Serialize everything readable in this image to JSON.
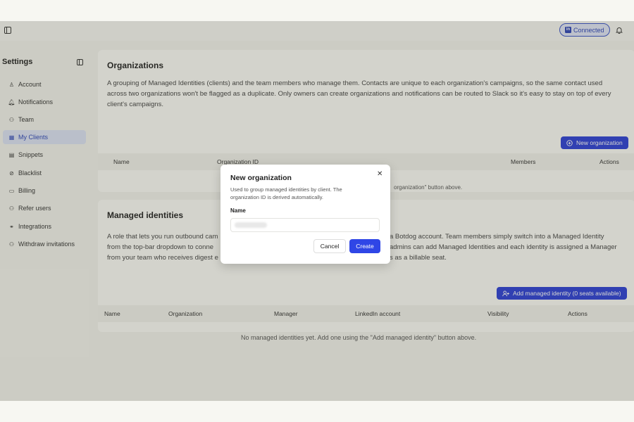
{
  "topbar": {
    "connected_label": "Connected",
    "linkedin_icon": "linkedin-icon",
    "bell_icon": "bell-icon"
  },
  "sidebar": {
    "title": "Settings",
    "items": [
      {
        "label": "Account",
        "icon": "user-icon",
        "glyph": "♙"
      },
      {
        "label": "Notifications",
        "icon": "bell-icon",
        "glyph": "🔔︎"
      },
      {
        "label": "Team",
        "icon": "team-icon",
        "glyph": "⚇"
      },
      {
        "label": "My Clients",
        "icon": "building-icon",
        "glyph": "▦",
        "active": true
      },
      {
        "label": "Snippets",
        "icon": "document-icon",
        "glyph": "▤"
      },
      {
        "label": "Blacklist",
        "icon": "ban-icon",
        "glyph": "⊘"
      },
      {
        "label": "Billing",
        "icon": "credit-card-icon",
        "glyph": "▭"
      },
      {
        "label": "Refer users",
        "icon": "user-plus-icon",
        "glyph": "⚇"
      },
      {
        "label": "Integrations",
        "icon": "link-icon",
        "glyph": "⚭"
      },
      {
        "label": "Withdraw invitations",
        "icon": "user-minus-icon",
        "glyph": "⚇"
      }
    ]
  },
  "organizations": {
    "title": "Organizations",
    "description": "A grouping of Managed Identities (clients) and the team members who manage them. Contacts are unique to each organization's campaigns, so the same contact used across two organizations won't be flagged as a duplicate. Only owners can create organizations and notifications can be routed to Slack so it's easy to stay on top of every client's campaigns.",
    "new_button": "New organization",
    "columns": [
      "Name",
      "Organization ID",
      "Members",
      "Actions"
    ],
    "empty_message": "organization\" button above."
  },
  "managed": {
    "title": "Managed identities",
    "description_lines": [
      "A role that lets you run outbound cam",
      "a Botdog account. Team members simply switch into a Managed Identity",
      "from the top-bar dropdown to conne",
      "admins can add Managed Identities and each identity is assigned a Manager",
      "from your team who receives digest e",
      "s as a billable seat."
    ],
    "add_button": "Add managed identity (0 seats available)",
    "columns": [
      "Name",
      "Organization",
      "Manager",
      "LinkedIn account",
      "Visibility",
      "Actions"
    ],
    "empty_message": "No managed identities yet. Add one using the \"Add managed identity\" button above."
  },
  "modal": {
    "title": "New organization",
    "description": "Used to group managed identities by client. The organization ID is derived automatically.",
    "name_label": "Name",
    "name_value": "",
    "cancel_label": "Cancel",
    "create_label": "Create",
    "close_glyph": "✕"
  },
  "colors": {
    "accent": "#2c3fd6",
    "active_bg": "#dbe2f5"
  }
}
